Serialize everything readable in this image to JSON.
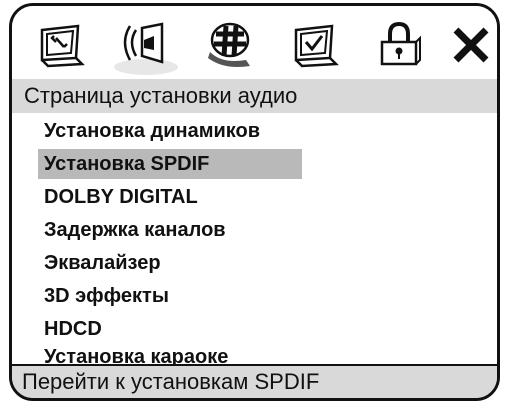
{
  "toolbar": {
    "icons": [
      {
        "name": "system-setup-icon"
      },
      {
        "name": "audio-setup-icon",
        "selected": true
      },
      {
        "name": "video-setup-icon"
      },
      {
        "name": "preferences-icon"
      },
      {
        "name": "lock-icon"
      },
      {
        "name": "close-icon"
      }
    ]
  },
  "page": {
    "title": "Страница установки аудио"
  },
  "menu": {
    "items": [
      {
        "label": "Установка динамиков"
      },
      {
        "label": "Установка SPDIF",
        "selected": true
      },
      {
        "label": "DOLBY DIGITAL"
      },
      {
        "label": "Задержка каналов"
      },
      {
        "label": "Эквалайзер"
      },
      {
        "label": "3D эффекты"
      },
      {
        "label": "HDCD"
      },
      {
        "label": "Установка караоке"
      }
    ]
  },
  "status": {
    "text": "Перейти к установкам SPDIF"
  },
  "colors": {
    "title_bar": "#d9d9d9",
    "selected_item": "#b9b9b9",
    "border": "#111111"
  }
}
